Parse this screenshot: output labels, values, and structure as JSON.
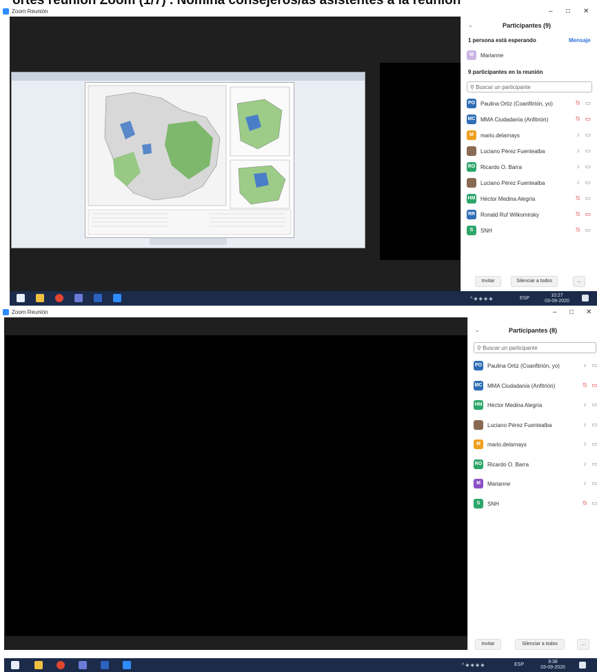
{
  "caption": "ortes reunión Zoom (1/7) . Nómina consejeros/as asistentes a la reunión",
  "icons": {
    "mic": "microphone-icon",
    "mic_muted": "microphone-muted-icon",
    "cam": "camera-icon",
    "cam_off": "camera-off-icon"
  },
  "shot1": {
    "window_title": "Zoom Reunión",
    "panel_title": "Participantes (9)",
    "waiting_label": "1 persona está esperando",
    "message_label": "Mensaje",
    "waiting_person": "Marianne",
    "in_meeting_label": "9 participantes en la reunión",
    "search_placeholder": "Buscar un participante",
    "participants": [
      {
        "initials": "PO",
        "name": "Paulina Ortiz (Coanfitrión, yo)",
        "color": "#2f6db5",
        "mic": "muted",
        "cam": "on"
      },
      {
        "initials": "MC",
        "name": "MMA Ciudadanía (Anfitrión)",
        "color": "#2f6db5",
        "mic": "muted",
        "cam": "off"
      },
      {
        "initials": "M",
        "name": "mario.delarnays",
        "color": "#f0a020",
        "mic": "on",
        "cam": "on"
      },
      {
        "initials": "",
        "name": "Luciano Pérez Fuentealba",
        "color": "#8a6a55",
        "mic": "on",
        "cam": "on"
      },
      {
        "initials": "RO",
        "name": "Ricardo O. Barra",
        "color": "#2da66a",
        "mic": "on",
        "cam": "on"
      },
      {
        "initials": "",
        "name": "Luciano Pérez Fuentealba",
        "color": "#8a6a55",
        "mic": "on",
        "cam": "on"
      },
      {
        "initials": "HM",
        "name": "Héctor Medina Alegría",
        "color": "#2da66a",
        "mic": "muted",
        "cam": "on"
      },
      {
        "initials": "RR",
        "name": "Ronald Ruf Wilkomirsky",
        "color": "#2f6db5",
        "mic": "muted",
        "cam": "off"
      },
      {
        "initials": "S",
        "name": "SNH",
        "color": "#2da66a",
        "mic": "muted",
        "cam": "on"
      }
    ],
    "invite_label": "Invitar",
    "mute_all_label": "Silenciar a todos",
    "more_label": "...",
    "tray_lang": "ESP",
    "clock_time": "10:27",
    "clock_date": "03-09-2020"
  },
  "shot2": {
    "window_title": "Zoom Reunión",
    "panel_title": "Participantes (8)",
    "search_placeholder": "Buscar un participante",
    "participants": [
      {
        "initials": "PO",
        "name": "Paulina Ortiz (Coanfitrión, yo)",
        "color": "#2f6db5",
        "mic": "on",
        "cam": "on"
      },
      {
        "initials": "MC",
        "name": "MMA Ciudadanía (Anfitrión)",
        "color": "#2f6db5",
        "mic": "muted",
        "cam": "off"
      },
      {
        "initials": "HM",
        "name": "Héctor Medina Alegría",
        "color": "#2da66a",
        "mic": "on",
        "cam": "on"
      },
      {
        "initials": "",
        "name": "Luciano Pérez Fuentealba",
        "color": "#8a6a55",
        "mic": "on",
        "cam": "on"
      },
      {
        "initials": "M",
        "name": "mario.delarnays",
        "color": "#f0a020",
        "mic": "on",
        "cam": "on"
      },
      {
        "initials": "RO",
        "name": "Ricardo O. Barra",
        "color": "#2da66a",
        "mic": "on",
        "cam": "on"
      },
      {
        "initials": "M",
        "name": "Marianne",
        "color": "#8a4fc4",
        "mic": "on",
        "cam": "on"
      },
      {
        "initials": "S",
        "name": "SNH",
        "color": "#2da66a",
        "mic": "muted",
        "cam": "on"
      }
    ],
    "invite_label": "Invitar",
    "mute_all_label": "Silenciar a todos",
    "more_label": "...",
    "tray_lang": "ESP",
    "clock_time": "9:38",
    "clock_date": "03-09-2020"
  }
}
